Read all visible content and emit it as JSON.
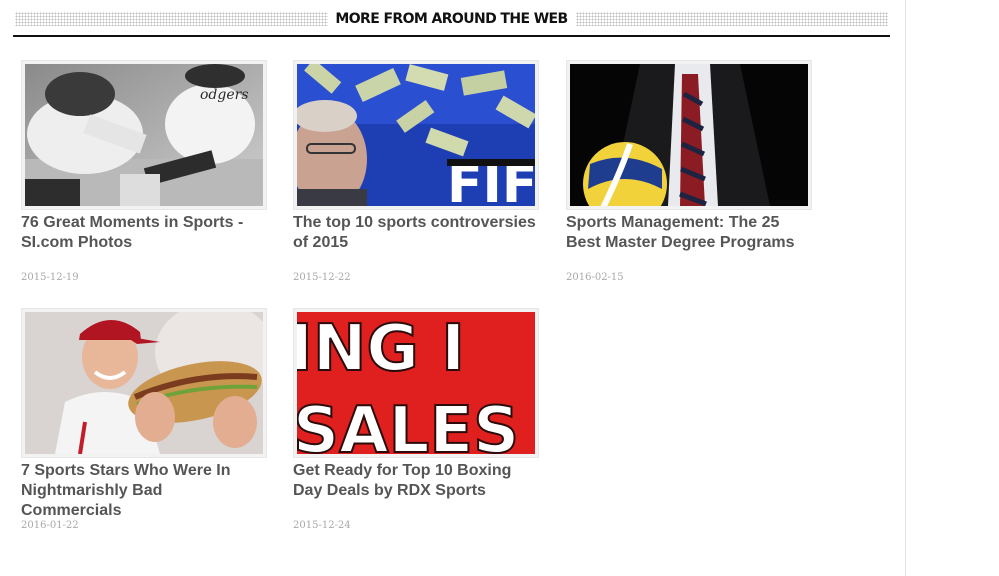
{
  "widget": {
    "heading": "More from around the web"
  },
  "articles": [
    {
      "title": "76 Great Moments in Sports - SI.com Photos",
      "date": "2015-12-19",
      "image": "baseball-slide-photo"
    },
    {
      "title": "The top 10 sports controversies of 2015",
      "date": "2015-12-22",
      "image": "fifa-money-photo"
    },
    {
      "title": "Sports Management: The 25 Best Master Degree Programs",
      "date": "2016-02-15",
      "image": "suit-volleyball-photo"
    },
    {
      "title": "7 Sports Stars Who Were In Nightmarishly Bad Commercials",
      "date": "2016-01-22",
      "image": "player-sandwich-photo"
    },
    {
      "title": "Get Ready for Top 10 Boxing Day Deals by RDX Sports",
      "date": "2015-12-24",
      "image": "sales-sign-photo"
    }
  ],
  "image_text": {
    "fifa_sign": "FIF",
    "sales_top": "ING I",
    "sales_bottom": "SALES"
  }
}
